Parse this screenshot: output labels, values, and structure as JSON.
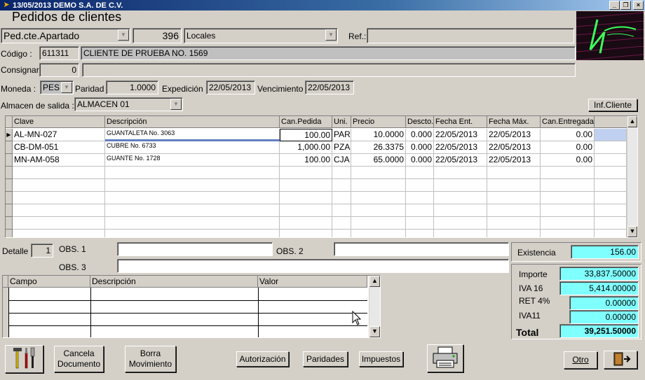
{
  "window": {
    "title": "13/05/2013  DEMO  S.A. DE C.V."
  },
  "form": {
    "heading": "Pedidos de clientes"
  },
  "header": {
    "doc_type": "Ped.cte.Apartado",
    "number": "396",
    "location": "Locales",
    "ref_label": "Ref.:",
    "ref_value": "",
    "codigo_label": "Código :",
    "codigo": "611311",
    "cliente": "CLIENTE DE PRUEBA NO. 1569",
    "consignar_label": "Consignar",
    "consignar_num": "0",
    "consignar_text": "",
    "moneda_label": "Moneda :",
    "moneda": "PES",
    "paridad_label": "Paridad",
    "paridad": "1.0000",
    "expedicion_label": "Expedición",
    "expedicion": "22/05/2013",
    "vencimiento_label": "Vencimiento",
    "vencimiento": "22/05/2013",
    "almacen_label": "Almacen de salida :",
    "almacen": "ALMACEN 01",
    "inf_cliente": "Inf.Cliente"
  },
  "grid": {
    "columns": [
      "Clave",
      "Descripción",
      "Can.Pedida",
      "Uni.",
      "Precio",
      "Descto.",
      "Fecha Ent.",
      "Fecha  Máx.",
      "Can.Entregada"
    ],
    "rows": [
      {
        "clave": "AL-MN-027",
        "descripcion": "GUANTALETA No. 3063",
        "cantidad": "100.00",
        "unidad": "PAR",
        "precio": "10.0000",
        "descto": "0.000",
        "fecha_ent": "22/05/2013",
        "fecha_max": "22/05/2013",
        "entregada": "0.00"
      },
      {
        "clave": "CB-DM-051",
        "descripcion": "CUBRE No. 6733",
        "cantidad": "1,000.00",
        "unidad": "PZA",
        "precio": "26.3375",
        "descto": "0.000",
        "fecha_ent": "22/05/2013",
        "fecha_max": "22/05/2013",
        "entregada": "0.00"
      },
      {
        "clave": "MN-AM-058",
        "descripcion": "GUANTE No. 1728",
        "cantidad": "100.00",
        "unidad": "CJA",
        "precio": "65.0000",
        "descto": "0.000",
        "fecha_ent": "22/05/2013",
        "fecha_max": "22/05/2013",
        "entregada": "0.00"
      }
    ]
  },
  "footer": {
    "detalle_label": "Detalle",
    "detalle": "1",
    "obs1_label": "OBS. 1",
    "obs2_label": "OBS. 2",
    "obs3_label": "OBS. 3",
    "grid2_columns": [
      "Campo",
      "Descripción",
      "Valor"
    ]
  },
  "totals": {
    "existencia_label": "Existencia",
    "existencia": "156.00",
    "importe_label": "Importe",
    "importe": "33,837.50000",
    "iva16_label": "IVA 16",
    "iva16": "5,414.00000",
    "ret4_label": "RET 4%",
    "ret4": "0.00000",
    "iva11_label": "IVA11",
    "iva11": "0.00000",
    "total_label": "Total",
    "total": "39,251.50000"
  },
  "buttons": {
    "cancela_1": "Cancela",
    "cancela_2": "Documento",
    "borra_1": "Borra",
    "borra_2": "Movimiento",
    "autorizacion": "Autorización",
    "paridades": "Paridades",
    "impuestos": "Impuestos",
    "otro": "Otro"
  }
}
